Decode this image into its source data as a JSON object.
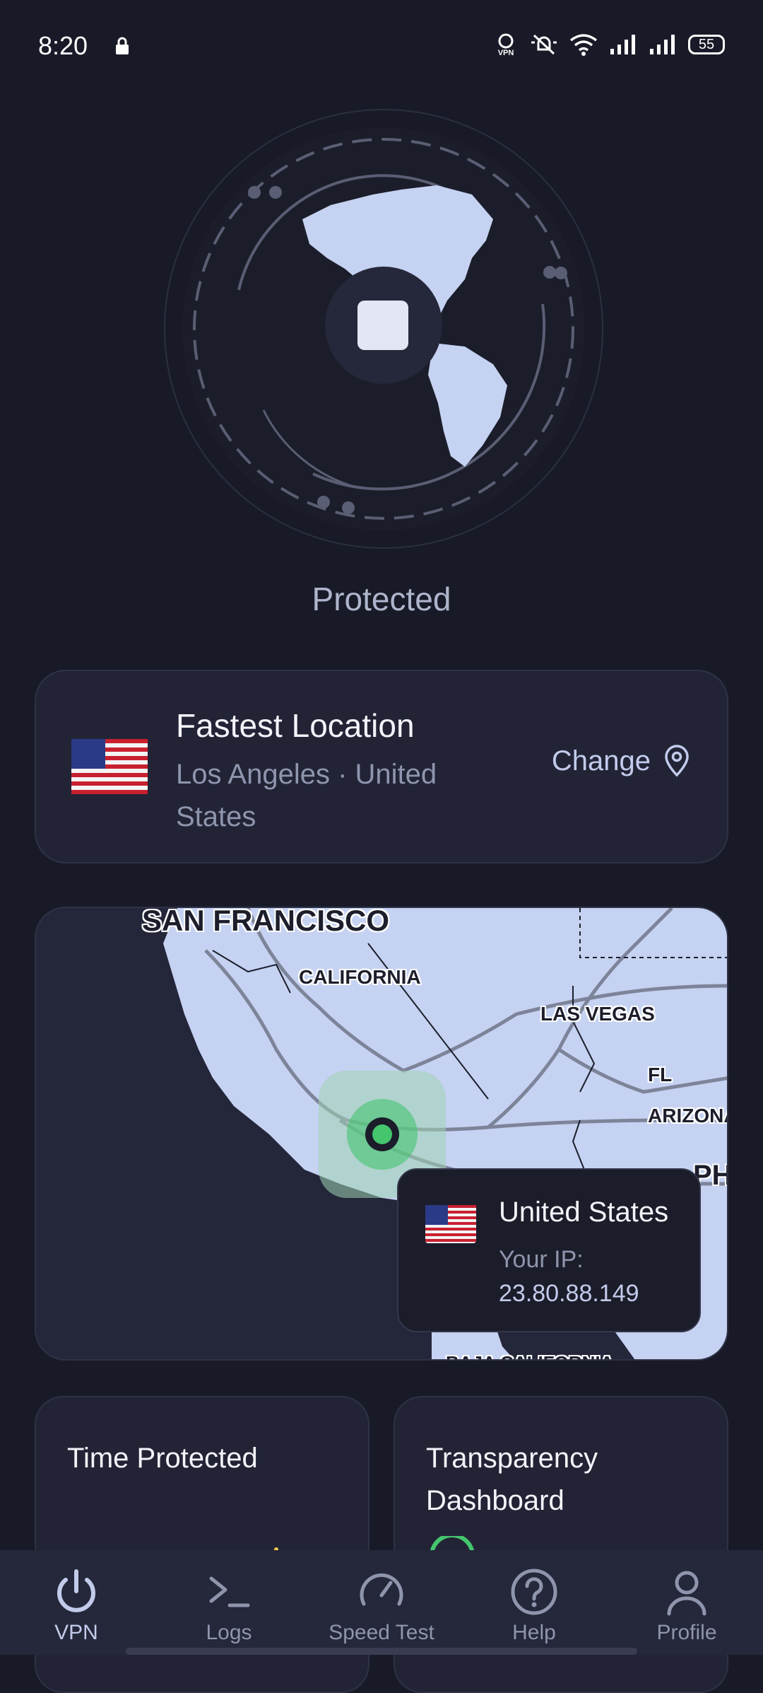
{
  "status_bar": {
    "time": "8:20",
    "battery": "55"
  },
  "connection": {
    "status": "Protected"
  },
  "location": {
    "title": "Fastest Location",
    "subtitle": "Los Angeles · United States",
    "change_label": "Change"
  },
  "map": {
    "labels": {
      "sf": "SAN FRANCISCO",
      "ca": "CALIFORNIA",
      "lv": "LAS VEGAS",
      "az": "ARIZONA",
      "fl": "FL",
      "ph": "PH",
      "baja": "BAJA CALIFORNIA"
    },
    "tooltip": {
      "country": "United States",
      "ip_label": "Your IP:",
      "ip": "23.80.88.149"
    }
  },
  "cards": {
    "time_protected": "Time Protected",
    "transparency": "Transparency Dashboard"
  },
  "nav": {
    "items": [
      {
        "label": "VPN",
        "icon": "power-icon"
      },
      {
        "label": "Logs",
        "icon": "terminal-icon"
      },
      {
        "label": "Speed Test",
        "icon": "speedometer-icon"
      },
      {
        "label": "Help",
        "icon": "question-icon"
      },
      {
        "label": "Profile",
        "icon": "user-icon"
      }
    ]
  },
  "colors": {
    "background": "#181a27",
    "card": "#222436",
    "accent": "#c3cbeb",
    "land": "#c5d2f2",
    "connected": "#44c56e"
  }
}
